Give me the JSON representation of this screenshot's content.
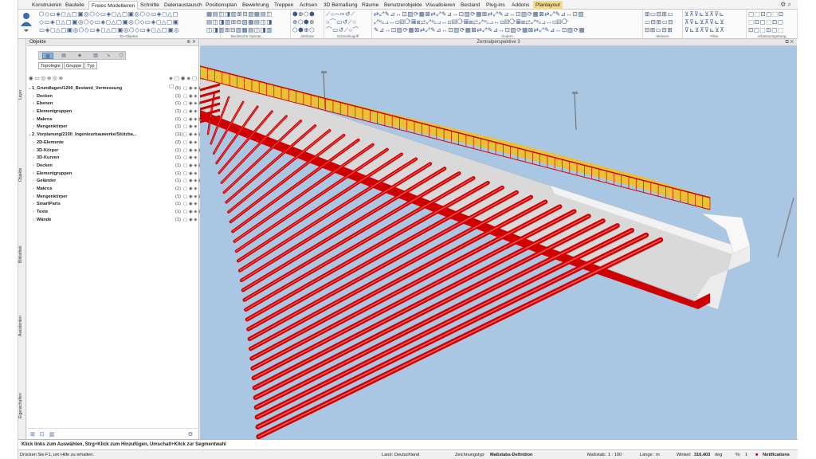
{
  "ribbon": {
    "tabs": [
      "Konstruieren",
      "Bauteile",
      "Freies Modellieren",
      "Schnitte",
      "Datenaustausch",
      "Positionsplan",
      "Bewehrung",
      "Treppen",
      "Achsen",
      "3D Bemaßung",
      "Räume",
      "Benutzerobjekte",
      "Visualisieren",
      "Bestand",
      "Plug-ins",
      "Addons",
      "Planlayout"
    ],
    "active_tab": "Freies Modellieren",
    "groups": [
      "3D-Objekte",
      "Boolesche Operati...",
      "Attribute",
      "Schnellzugriff",
      "Ändern",
      "Messen",
      "Filter",
      "Arbeitsumgebung"
    ]
  },
  "side_tabs": [
    "Layer",
    "Objekte",
    "Bibliothek",
    "Assistenten",
    "Eigenschaften"
  ],
  "panel": {
    "title": "Objekte",
    "filters": [
      "Topologie",
      "Gruppe",
      "Typ"
    ],
    "tree": [
      {
        "label": "1_Grundlagen/1200_Bestand_Vermessung",
        "count": "(5)",
        "level": 0,
        "bold": true
      },
      {
        "label": "Decken",
        "count": "(1)",
        "level": 1,
        "bold": true
      },
      {
        "label": "Ebenen",
        "count": "(1)",
        "level": 1,
        "bold": true
      },
      {
        "label": "Elementgruppen",
        "count": "(1)",
        "level": 1,
        "bold": true
      },
      {
        "label": "Makros",
        "count": "(1)",
        "level": 1,
        "bold": true
      },
      {
        "label": "Mengenkörper",
        "count": "(1)",
        "level": 1,
        "bold": true
      },
      {
        "label": "2_Vorplanung/2100_Ingenieurbauwerke/Stützba...",
        "count": "(11)",
        "level": 0,
        "bold": true
      },
      {
        "label": "2D-Elemente",
        "count": "(3)",
        "level": 1,
        "bold": true
      },
      {
        "label": "3D-Körper",
        "count": "(1)",
        "level": 1,
        "bold": true
      },
      {
        "label": "3D-Kurven",
        "count": "(1)",
        "level": 1,
        "bold": true
      },
      {
        "label": "Decken",
        "count": "(1)",
        "level": 1,
        "bold": true
      },
      {
        "label": "Elementgruppen",
        "count": "(1)",
        "level": 1,
        "bold": true
      },
      {
        "label": "Geländer",
        "count": "(1)",
        "level": 1,
        "bold": true
      },
      {
        "label": "Makros",
        "count": "(1)",
        "level": 1,
        "bold": true
      },
      {
        "label": "Mengenkörper",
        "count": "(1)",
        "level": 1,
        "bold": true
      },
      {
        "label": "SmartParts",
        "count": "(1)",
        "level": 1,
        "bold": true
      },
      {
        "label": "Texte",
        "count": "(1)",
        "level": 1,
        "bold": true
      },
      {
        "label": "Wände",
        "count": "(1)",
        "level": 1,
        "bold": true
      }
    ]
  },
  "viewport": {
    "title": "Zentralperspektive 3"
  },
  "status": {
    "hint": "Klick links zum Auswählen, Strg+Klick zum Hinzufügen, Umschalt+Klick zur Segmentwahl",
    "help": "Drücken Sie F1, um Hilfe zu erhalten.",
    "land_label": "Land:",
    "land": "Deutschland",
    "zeichnungstyp_label": "Zeichnungstyp:",
    "zeichnungstyp": "Maßstabs-Definition",
    "massstab_label": "Maßstab:",
    "massstab": "1 : 100",
    "laenge_label": "Länge:",
    "laenge": "m",
    "winkel_label": "Winkel:",
    "winkel": "316.403",
    "winkel_unit": "deg",
    "percent_label": "%:",
    "percent": "1",
    "notifications": "Notifications"
  },
  "colors": {
    "sky": "#a9c6e3",
    "steel": "#d10000",
    "railing": "#f0c020",
    "concrete": "#d9d9d9"
  }
}
